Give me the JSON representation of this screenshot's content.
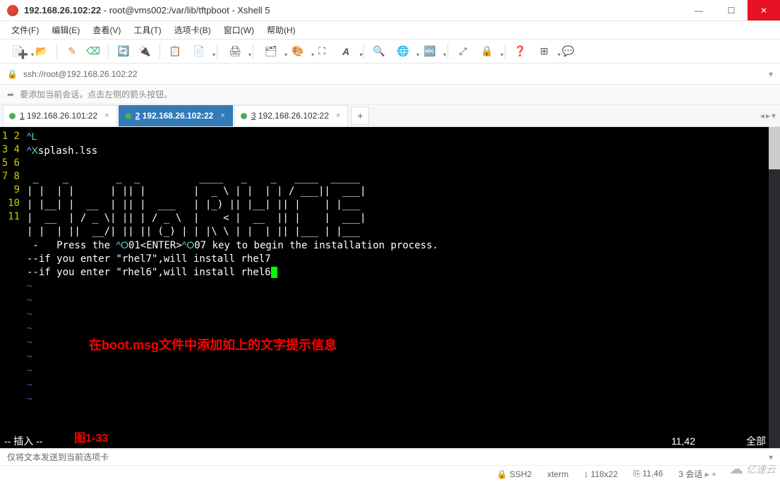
{
  "window": {
    "title_bold": "192.168.26.102:22",
    "title_rest": " - root@vms002:/var/lib/tftpboot - Xshell 5"
  },
  "menu": {
    "items": [
      "文件(F)",
      "编辑(E)",
      "查看(V)",
      "工具(T)",
      "选项卡(B)",
      "窗口(W)",
      "帮助(H)"
    ]
  },
  "address": {
    "url": "ssh://root@192.168.26.102:22"
  },
  "hint": {
    "text": "要添加当前会话，点击左侧的箭头按钮。"
  },
  "tabs": [
    {
      "label_prefix": "1",
      "label_rest": " 192.168.26.101:22",
      "active": false
    },
    {
      "label_prefix": "2",
      "label_rest": " 192.168.26.102:22",
      "active": true
    },
    {
      "label_prefix": "3",
      "label_rest": " 192.168.26.102:22",
      "active": false
    }
  ],
  "terminal": {
    "gutter": [
      "1",
      "2",
      "3",
      "4",
      "5",
      "6",
      "7",
      "8",
      "9",
      "10",
      "11"
    ],
    "lines": [
      "^L",
      "^Xsplash.lss",
      "",
      " _    _        _  _          ____   _    _   ____  _____",
      "| |  | |      | || |        |  _ \\ | |  | | / ___||  ___|",
      "| |__| |  __  | || |  ___   | |_) || |__| || |    | |___",
      "|  __  | / _ \\| || | / _ \\  |    < |  __  || |    |  ___|",
      "| |  | ||  __/| || || (_) | | |\\ \\ | |  | || |___ | |___",
      " -   Press the ^O01<ENTER>^O07 key to begin the installation process.",
      "--if you enter \"rhel7\",will install rhel7",
      "--if you enter \"rhel6\",will install rhel6"
    ],
    "tildes_count": 9,
    "annotation": "在boot.msg文件中添加如上的文字提示信息",
    "caption": "图1-33",
    "vim_mode": "-- 插入 --",
    "vim_pos": "11,42",
    "vim_all": "全部"
  },
  "footer1": {
    "text": "仅将文本发送到当前选项卡"
  },
  "footer2": {
    "proto": "SSH2",
    "term": "xterm",
    "size": "118x22",
    "cursor": "11,46",
    "sessions": "3 会话"
  },
  "icons": {
    "new": "📄",
    "open": "📁",
    "magic": "🪄",
    "wand": "🖊",
    "reconnect": "🔄",
    "disconnect": "🔌",
    "copy": "📋",
    "paste": "📄",
    "print": "🖨",
    "props": "🗂",
    "color": "🎨",
    "fullscreen": "⛶",
    "font": "A",
    "search": "🔍",
    "lang": "🌐",
    "encode": "🔤",
    "expand": "⤢",
    "lock": "🔒",
    "help": "❓",
    "layout": "⊞",
    "chat": "💬",
    "lock2": "🔒",
    "arrow": "➦",
    "updown": "↕",
    "ruler": "📏",
    "dropdown": "▾"
  },
  "watermark": "亿速云"
}
